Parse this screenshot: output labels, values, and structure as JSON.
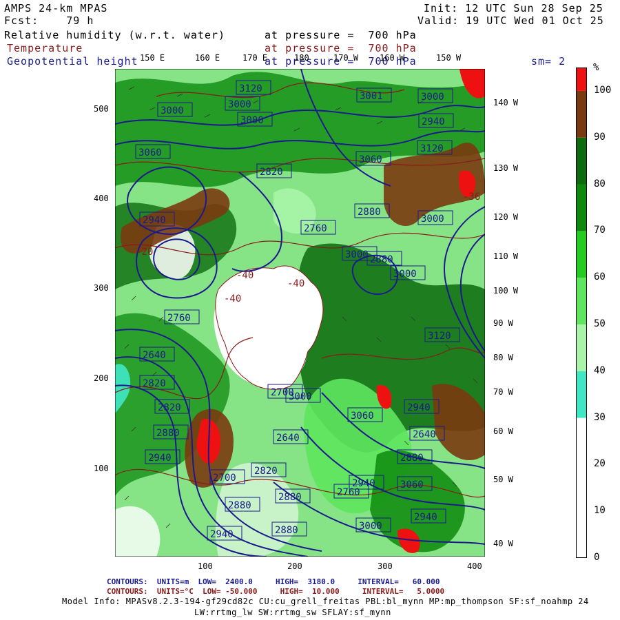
{
  "header": {
    "model": "AMPS 24-km MPAS",
    "fcst_label": "Fcst:",
    "fcst_value": "79 h",
    "init_label": "Init:",
    "init_value": "12 UTC Sun 28 Sep 25",
    "valid_label": "Valid:",
    "valid_value": "19 UTC Wed 01 Oct 25"
  },
  "fields": [
    {
      "name": "Relative humidity (w.r.t. water)",
      "level": "at pressure =  700 hPa",
      "color": "#000000"
    },
    {
      "name": "Temperature",
      "level": "at pressure =  700 hPa",
      "color": "#8b1a1a"
    },
    {
      "name": "Geopotential height",
      "level": "at pressure =  700 hPa",
      "color": "#1a1a8c"
    }
  ],
  "smoothing": "sm= 2",
  "longitude_top": [
    "150 E",
    "160 E",
    "170 E",
    "180",
    "170 W",
    "160 W",
    "150 W"
  ],
  "longitude_right": [
    "140 W",
    "130 W",
    "120 W",
    "110 W",
    "100 W",
    "90 W",
    "80 W",
    "70 W",
    "60 W",
    "50 W",
    "40 W"
  ],
  "axis_left": [
    "500",
    "400",
    "300",
    "200",
    "100"
  ],
  "axis_bottom": [
    "100",
    "200",
    "300",
    "400"
  ],
  "colorbar": {
    "unit": "%",
    "labels": [
      "100",
      "90",
      "80",
      "70",
      "60",
      "50",
      "40",
      "30",
      "20",
      "10",
      "0"
    ],
    "bins": [
      {
        "from": 0,
        "to": 30,
        "color": "#ffffff"
      },
      {
        "from": 30,
        "to": 40,
        "color": "#3fe8c4"
      },
      {
        "from": 40,
        "to": 50,
        "color": "#a8f5a8"
      },
      {
        "from": 50,
        "to": 60,
        "color": "#5ee65e"
      },
      {
        "from": 60,
        "to": 70,
        "color": "#22cc22"
      },
      {
        "from": 70,
        "to": 80,
        "color": "#0d8a0d"
      },
      {
        "from": 80,
        "to": 90,
        "color": "#0c6b0c"
      },
      {
        "from": 90,
        "to": 100,
        "color": "#7a3a10"
      },
      {
        "from": 100,
        "to": 105,
        "color": "#ee1111"
      }
    ]
  },
  "height_labels": [
    "3120",
    "3000",
    "3000",
    "3000",
    "2940",
    "3001",
    "3120",
    "3060",
    "2880",
    "3000",
    "3060",
    "2820",
    "2760",
    "2940",
    "2760",
    "3000",
    "2640",
    "3000",
    "2820",
    "2820",
    "2880",
    "2700",
    "2940",
    "2640",
    "2700",
    "2820",
    "2640",
    "2880",
    "2880",
    "2760",
    "2880",
    "2940",
    "3000",
    "2940",
    "3060",
    "2880",
    "2940",
    "3000",
    "2880",
    "3060",
    "3120",
    "2940",
    "3000"
  ],
  "temp_labels": [
    "-40",
    "-40",
    "-20",
    "-40",
    "-36"
  ],
  "contour_info": {
    "height": {
      "label": "CONTOURS:  UNITS=m  LOW=  2400.0",
      "high": "HIGH=  3180.0",
      "interval": "INTERVAL=   60.000",
      "color": "#1a1a8c"
    },
    "temp": {
      "label": "CONTOURS:  UNITS=°C  LOW= -50.000",
      "high": "HIGH=  10.000",
      "interval": "INTERVAL=   5.0000",
      "color": "#8b1a1a"
    }
  },
  "model_info_1": "Model Info: MPASv8.2.3-194-gf29cd82c CU:cu_grell_freitas PBL:bl_mynn MP:mp_thompson SF:sf_noahmp 24",
  "model_info_2": "LW:rrtmg_lw SW:rrtmg_sw SFLAY:sf_mynn"
}
